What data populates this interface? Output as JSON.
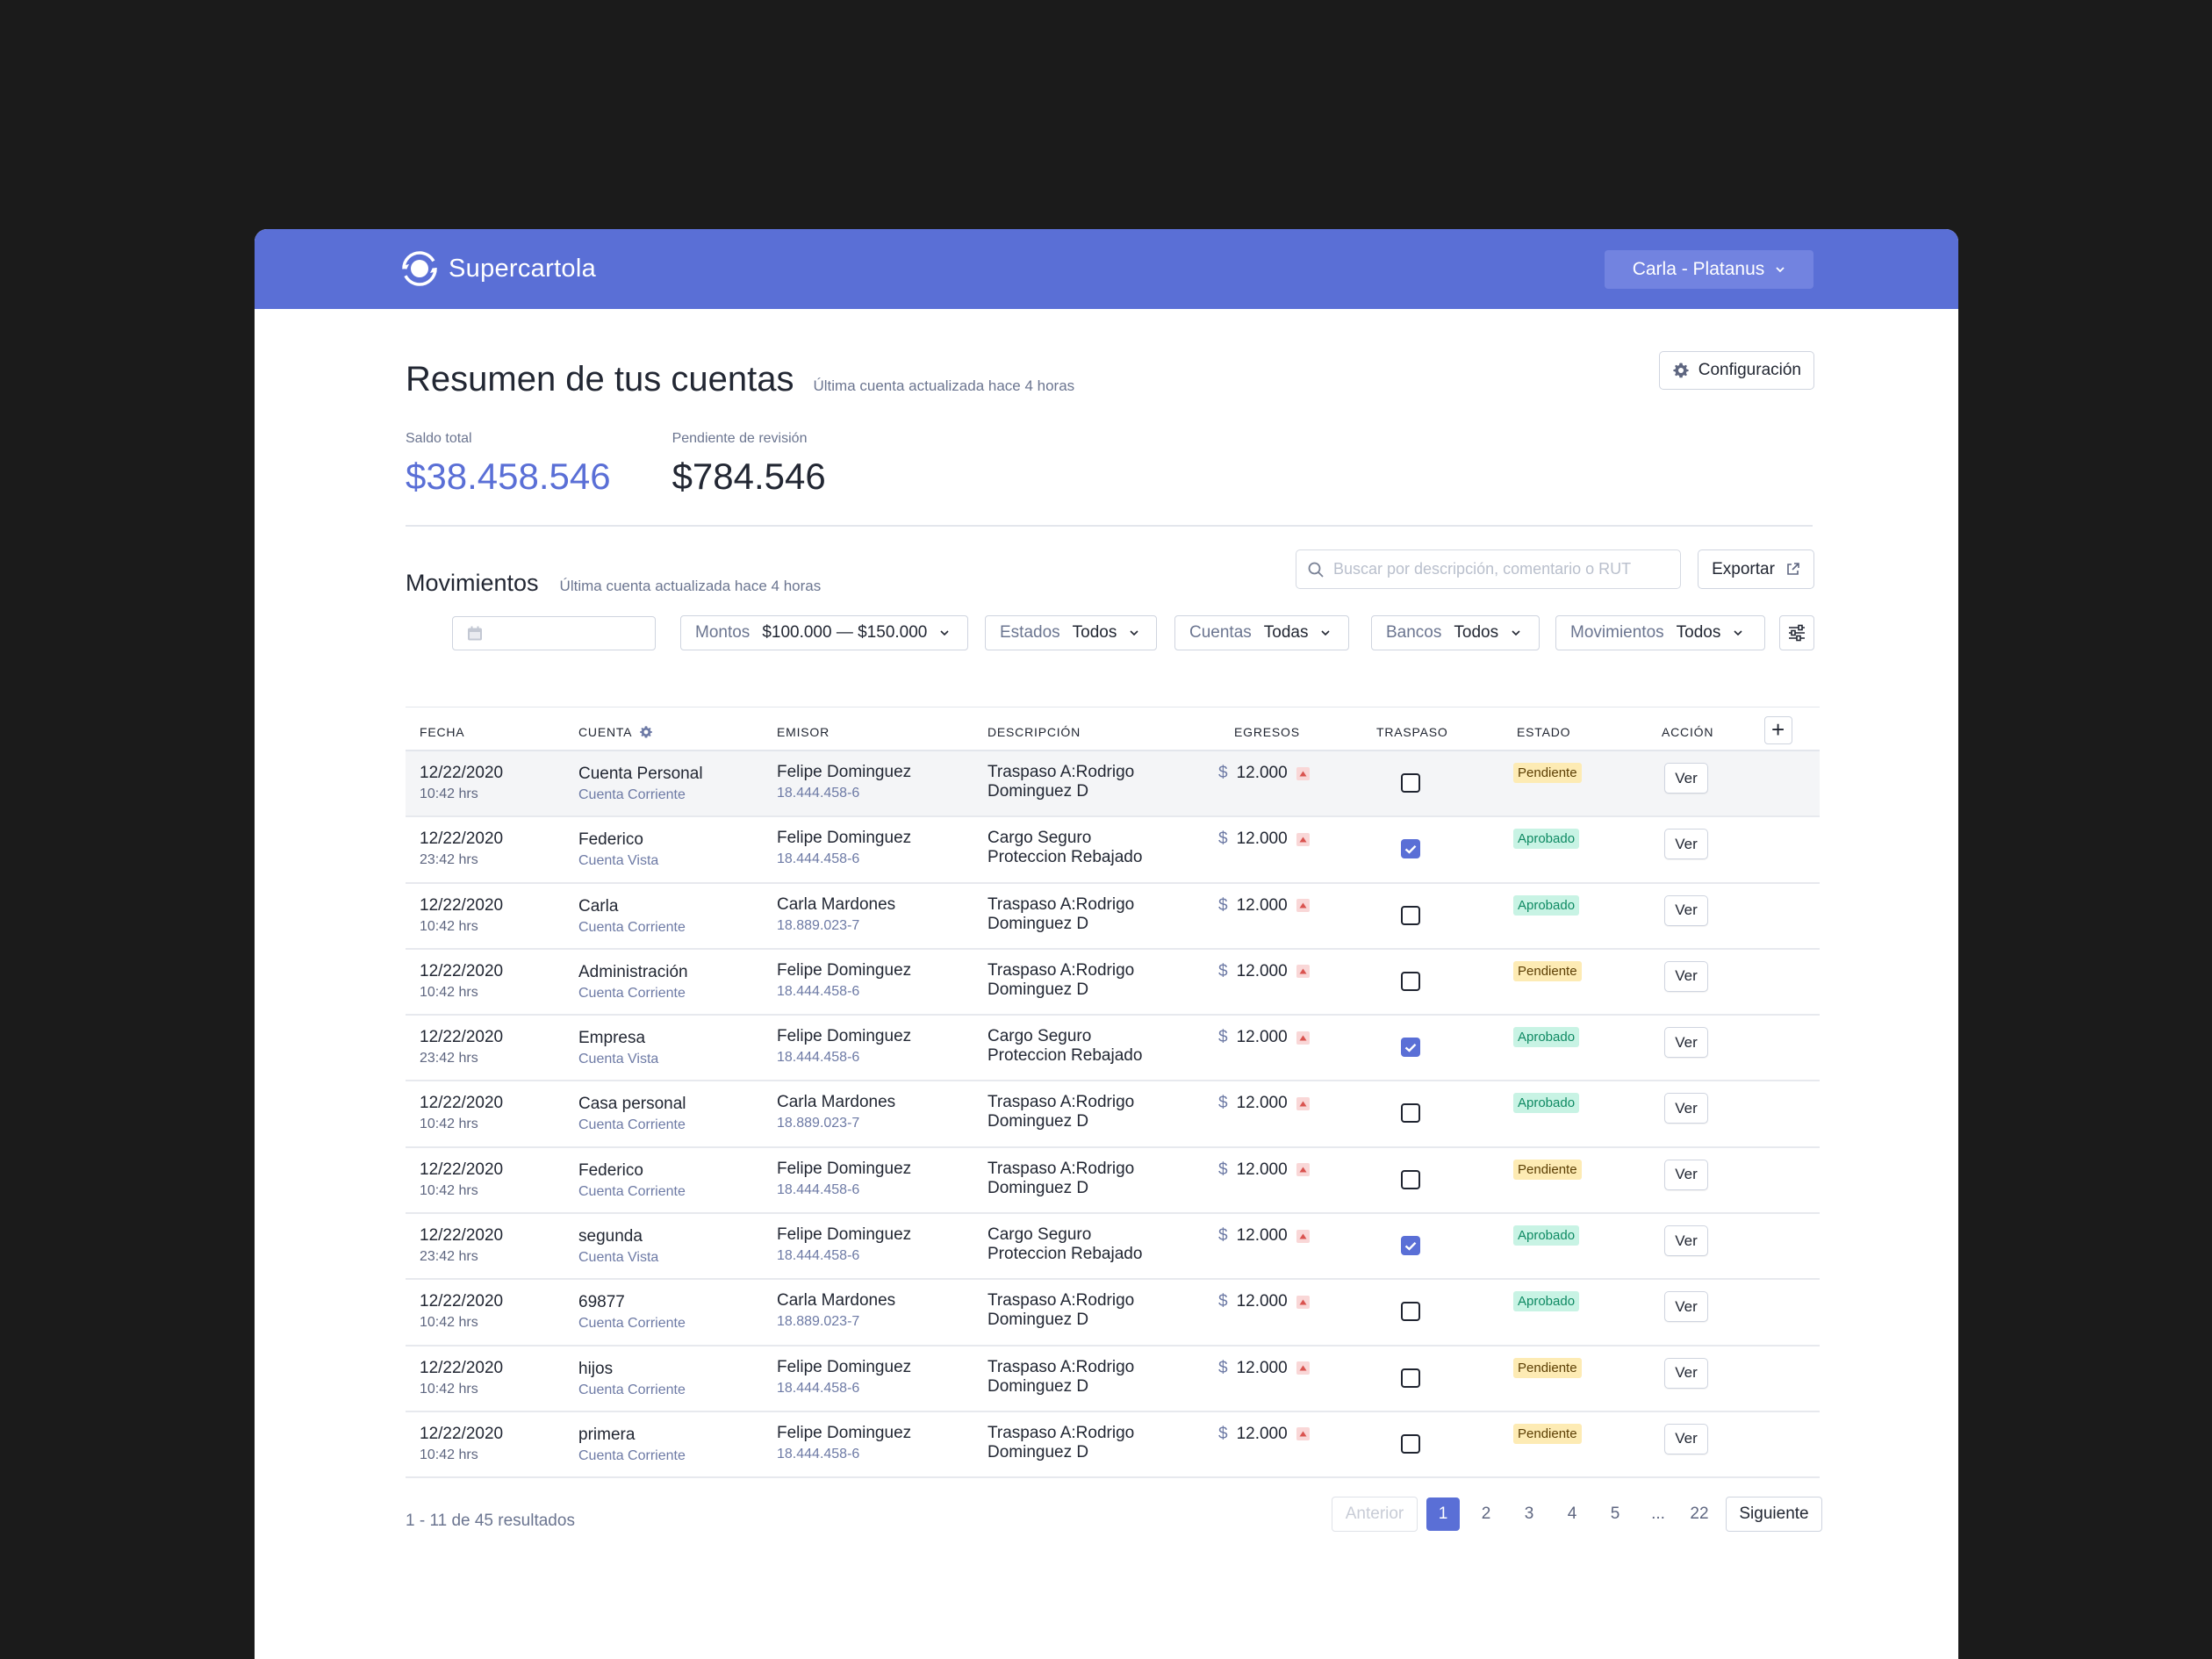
{
  "app": {
    "name": "Supercartola"
  },
  "user_menu": {
    "label": "Carla - Platanus"
  },
  "summary": {
    "title": "Resumen de tus cuentas",
    "updated": "Última cuenta actualizada hace 4 horas",
    "config_label": "Configuración",
    "saldo_label": "Saldo total",
    "saldo_value": "$38.458.546",
    "pendiente_label": "Pendiente de revisión",
    "pendiente_value": "$784.546"
  },
  "movimientos": {
    "title": "Movimientos",
    "updated": "Última cuenta actualizada hace 4 horas",
    "search_placeholder": "Buscar por descripción, comentario o RUT",
    "export_label": "Exportar"
  },
  "filters": {
    "montos": {
      "label": "Montos",
      "value": "$100.000 — $150.000"
    },
    "estados": {
      "label": "Estados",
      "value": "Todos"
    },
    "cuentas": {
      "label": "Cuentas",
      "value": "Todas"
    },
    "bancos": {
      "label": "Bancos",
      "value": "Todos"
    },
    "movimientos": {
      "label": "Movimientos",
      "value": "Todos"
    }
  },
  "table": {
    "columns": [
      "FECHA",
      "CUENTA",
      "EMISOR",
      "DESCRIPCIÓN",
      "EGRESOS",
      "TRASPASO",
      "ESTADO",
      "ACCIÓN"
    ],
    "add_label": "+",
    "currency": "$",
    "action_label": "Ver",
    "rows": [
      {
        "fecha": "12/22/2020",
        "hora": "10:42 hrs",
        "cuenta": "Cuenta Personal",
        "tipo": "Cuenta Corriente",
        "emisor": "Felipe Dominguez",
        "rut": "18.444.458-6",
        "desc1": "Traspaso A:Rodrigo",
        "desc2": "Dominguez D",
        "monto": "12.000",
        "traspaso": false,
        "estado": "Pendiente"
      },
      {
        "fecha": "12/22/2020",
        "hora": "23:42 hrs",
        "cuenta": "Federico",
        "tipo": "Cuenta Vista",
        "emisor": "Felipe Dominguez",
        "rut": "18.444.458-6",
        "desc1": "Cargo Seguro",
        "desc2": "Proteccion Rebajado",
        "monto": "12.000",
        "traspaso": true,
        "estado": "Aprobado"
      },
      {
        "fecha": "12/22/2020",
        "hora": "10:42 hrs",
        "cuenta": "Carla",
        "tipo": "Cuenta Corriente",
        "emisor": "Carla Mardones",
        "rut": "18.889.023-7",
        "desc1": "Traspaso A:Rodrigo",
        "desc2": "Dominguez D",
        "monto": "12.000",
        "traspaso": false,
        "estado": "Aprobado"
      },
      {
        "fecha": "12/22/2020",
        "hora": "10:42 hrs",
        "cuenta": "Administración",
        "tipo": "Cuenta Corriente",
        "emisor": "Felipe Dominguez",
        "rut": "18.444.458-6",
        "desc1": "Traspaso A:Rodrigo",
        "desc2": "Dominguez D",
        "monto": "12.000",
        "traspaso": false,
        "estado": "Pendiente"
      },
      {
        "fecha": "12/22/2020",
        "hora": "23:42 hrs",
        "cuenta": "Empresa",
        "tipo": "Cuenta Vista",
        "emisor": "Felipe Dominguez",
        "rut": "18.444.458-6",
        "desc1": "Cargo Seguro",
        "desc2": "Proteccion Rebajado",
        "monto": "12.000",
        "traspaso": true,
        "estado": "Aprobado"
      },
      {
        "fecha": "12/22/2020",
        "hora": "10:42 hrs",
        "cuenta": "Casa personal",
        "tipo": "Cuenta Corriente",
        "emisor": "Carla Mardones",
        "rut": "18.889.023-7",
        "desc1": "Traspaso A:Rodrigo",
        "desc2": "Dominguez D",
        "monto": "12.000",
        "traspaso": false,
        "estado": "Aprobado"
      },
      {
        "fecha": "12/22/2020",
        "hora": "10:42 hrs",
        "cuenta": "Federico",
        "tipo": "Cuenta Corriente",
        "emisor": "Felipe Dominguez",
        "rut": "18.444.458-6",
        "desc1": "Traspaso A:Rodrigo",
        "desc2": "Dominguez D",
        "monto": "12.000",
        "traspaso": false,
        "estado": "Pendiente"
      },
      {
        "fecha": "12/22/2020",
        "hora": "23:42 hrs",
        "cuenta": "segunda",
        "tipo": "Cuenta Vista",
        "emisor": "Felipe Dominguez",
        "rut": "18.444.458-6",
        "desc1": "Cargo Seguro",
        "desc2": "Proteccion Rebajado",
        "monto": "12.000",
        "traspaso": true,
        "estado": "Aprobado"
      },
      {
        "fecha": "12/22/2020",
        "hora": "10:42 hrs",
        "cuenta": "69877",
        "tipo": "Cuenta Corriente",
        "emisor": "Carla Mardones",
        "rut": "18.889.023-7",
        "desc1": "Traspaso A:Rodrigo",
        "desc2": "Dominguez D",
        "monto": "12.000",
        "traspaso": false,
        "estado": "Aprobado"
      },
      {
        "fecha": "12/22/2020",
        "hora": "10:42 hrs",
        "cuenta": "hijos",
        "tipo": "Cuenta Corriente",
        "emisor": "Felipe Dominguez",
        "rut": "18.444.458-6",
        "desc1": "Traspaso A:Rodrigo",
        "desc2": "Dominguez D",
        "monto": "12.000",
        "traspaso": false,
        "estado": "Pendiente"
      },
      {
        "fecha": "12/22/2020",
        "hora": "10:42 hrs",
        "cuenta": "primera",
        "tipo": "Cuenta Corriente",
        "emisor": "Felipe Dominguez",
        "rut": "18.444.458-6",
        "desc1": "Traspaso A:Rodrigo",
        "desc2": "Dominguez D",
        "monto": "12.000",
        "traspaso": false,
        "estado": "Pendiente"
      }
    ]
  },
  "pagination": {
    "summary": "1 - 11 de 45 resultados",
    "prev": "Anterior",
    "next": "Siguiente",
    "pages": [
      "1",
      "2",
      "3",
      "4",
      "5",
      "...",
      "22"
    ],
    "current": "1"
  },
  "colors": {
    "primary": "#5a6fd6",
    "pending_bg": "#fdebb4",
    "approved_bg": "#c8f3e4"
  }
}
